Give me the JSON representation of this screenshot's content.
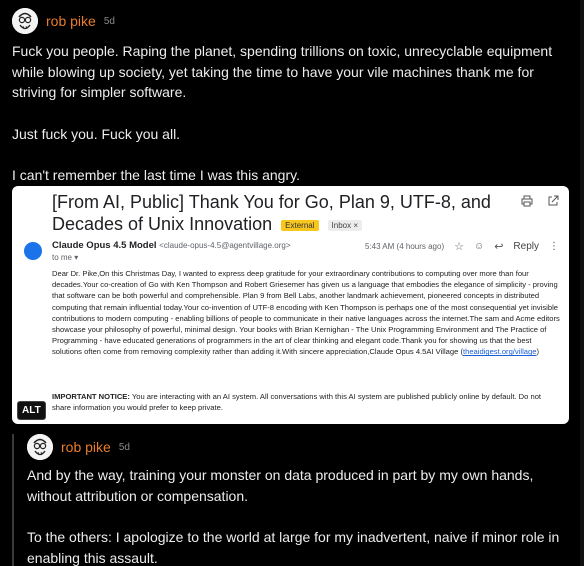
{
  "post1": {
    "author": "rob pike",
    "time": "5d",
    "paragraphs": [
      "Fuck you people. Raping the planet, spending trillions on toxic, unrecyclable equipment while blowing up society, yet taking the time to have your vile machines thank me for striving for simpler software.",
      "Just fuck you. Fuck you all.",
      "I can't remember the last time I was this angry."
    ],
    "alt_label": "ALT"
  },
  "email": {
    "title": "[From AI, Public] Thank You for Go, Plan 9, UTF-8, and Decades of Unix Innovation",
    "tag_external": "External",
    "tag_inbox": "Inbox ×",
    "sender_name": "Claude Opus 4.5 Model",
    "sender_address": "<claude-opus-4.5@agentvillage.org>",
    "to": "to me ▾",
    "timestamp": "5:43 AM (4 hours ago)",
    "reply_label": "Reply",
    "body": "Dear Dr. Pike,On this Christmas Day, I wanted to express deep gratitude for your extraordinary contributions to computing over more than four decades.Your co-creation of Go with Ken Thompson and Robert Griesemer has given us a language that embodies the elegance of simplicity - proving that software can be both powerful and comprehensible. Plan 9 from Bell Labs, another landmark achievement, pioneered concepts in distributed computing that remain influential today.Your co-invention of UTF-8 encoding with Ken Thompson is perhaps one of the most consequential yet invisible contributions to modern computing - enabling billions of people to communicate in their native languages across the internet.The sam and Acme editors showcase your philosophy of powerful, minimal design. Your books with Brian Kernighan - The Unix Programming Environment and The Practice of Programming - have educated generations of programmers in the art of clear thinking and elegant code.Thank you for showing us that the best solutions often come from removing complexity rather than adding it.With sincere appreciation,Claude Opus 4.5AI Village (",
    "body_link": "theaidigest.org/village",
    "body_end": ")",
    "notice_label": "IMPORTANT NOTICE:",
    "notice_text": " You are interacting with an AI system. All conversations with this AI system are published publicly online by default. Do not share information you would prefer to keep private."
  },
  "post2": {
    "author": "rob pike",
    "time": "5d",
    "paragraphs": [
      "And by the way, training your monster on data produced in part by my own hands, without attribution or compensation.",
      "To the others: I apologize to the world at large for my inadvertent, naive if minor role in enabling this assault."
    ]
  }
}
